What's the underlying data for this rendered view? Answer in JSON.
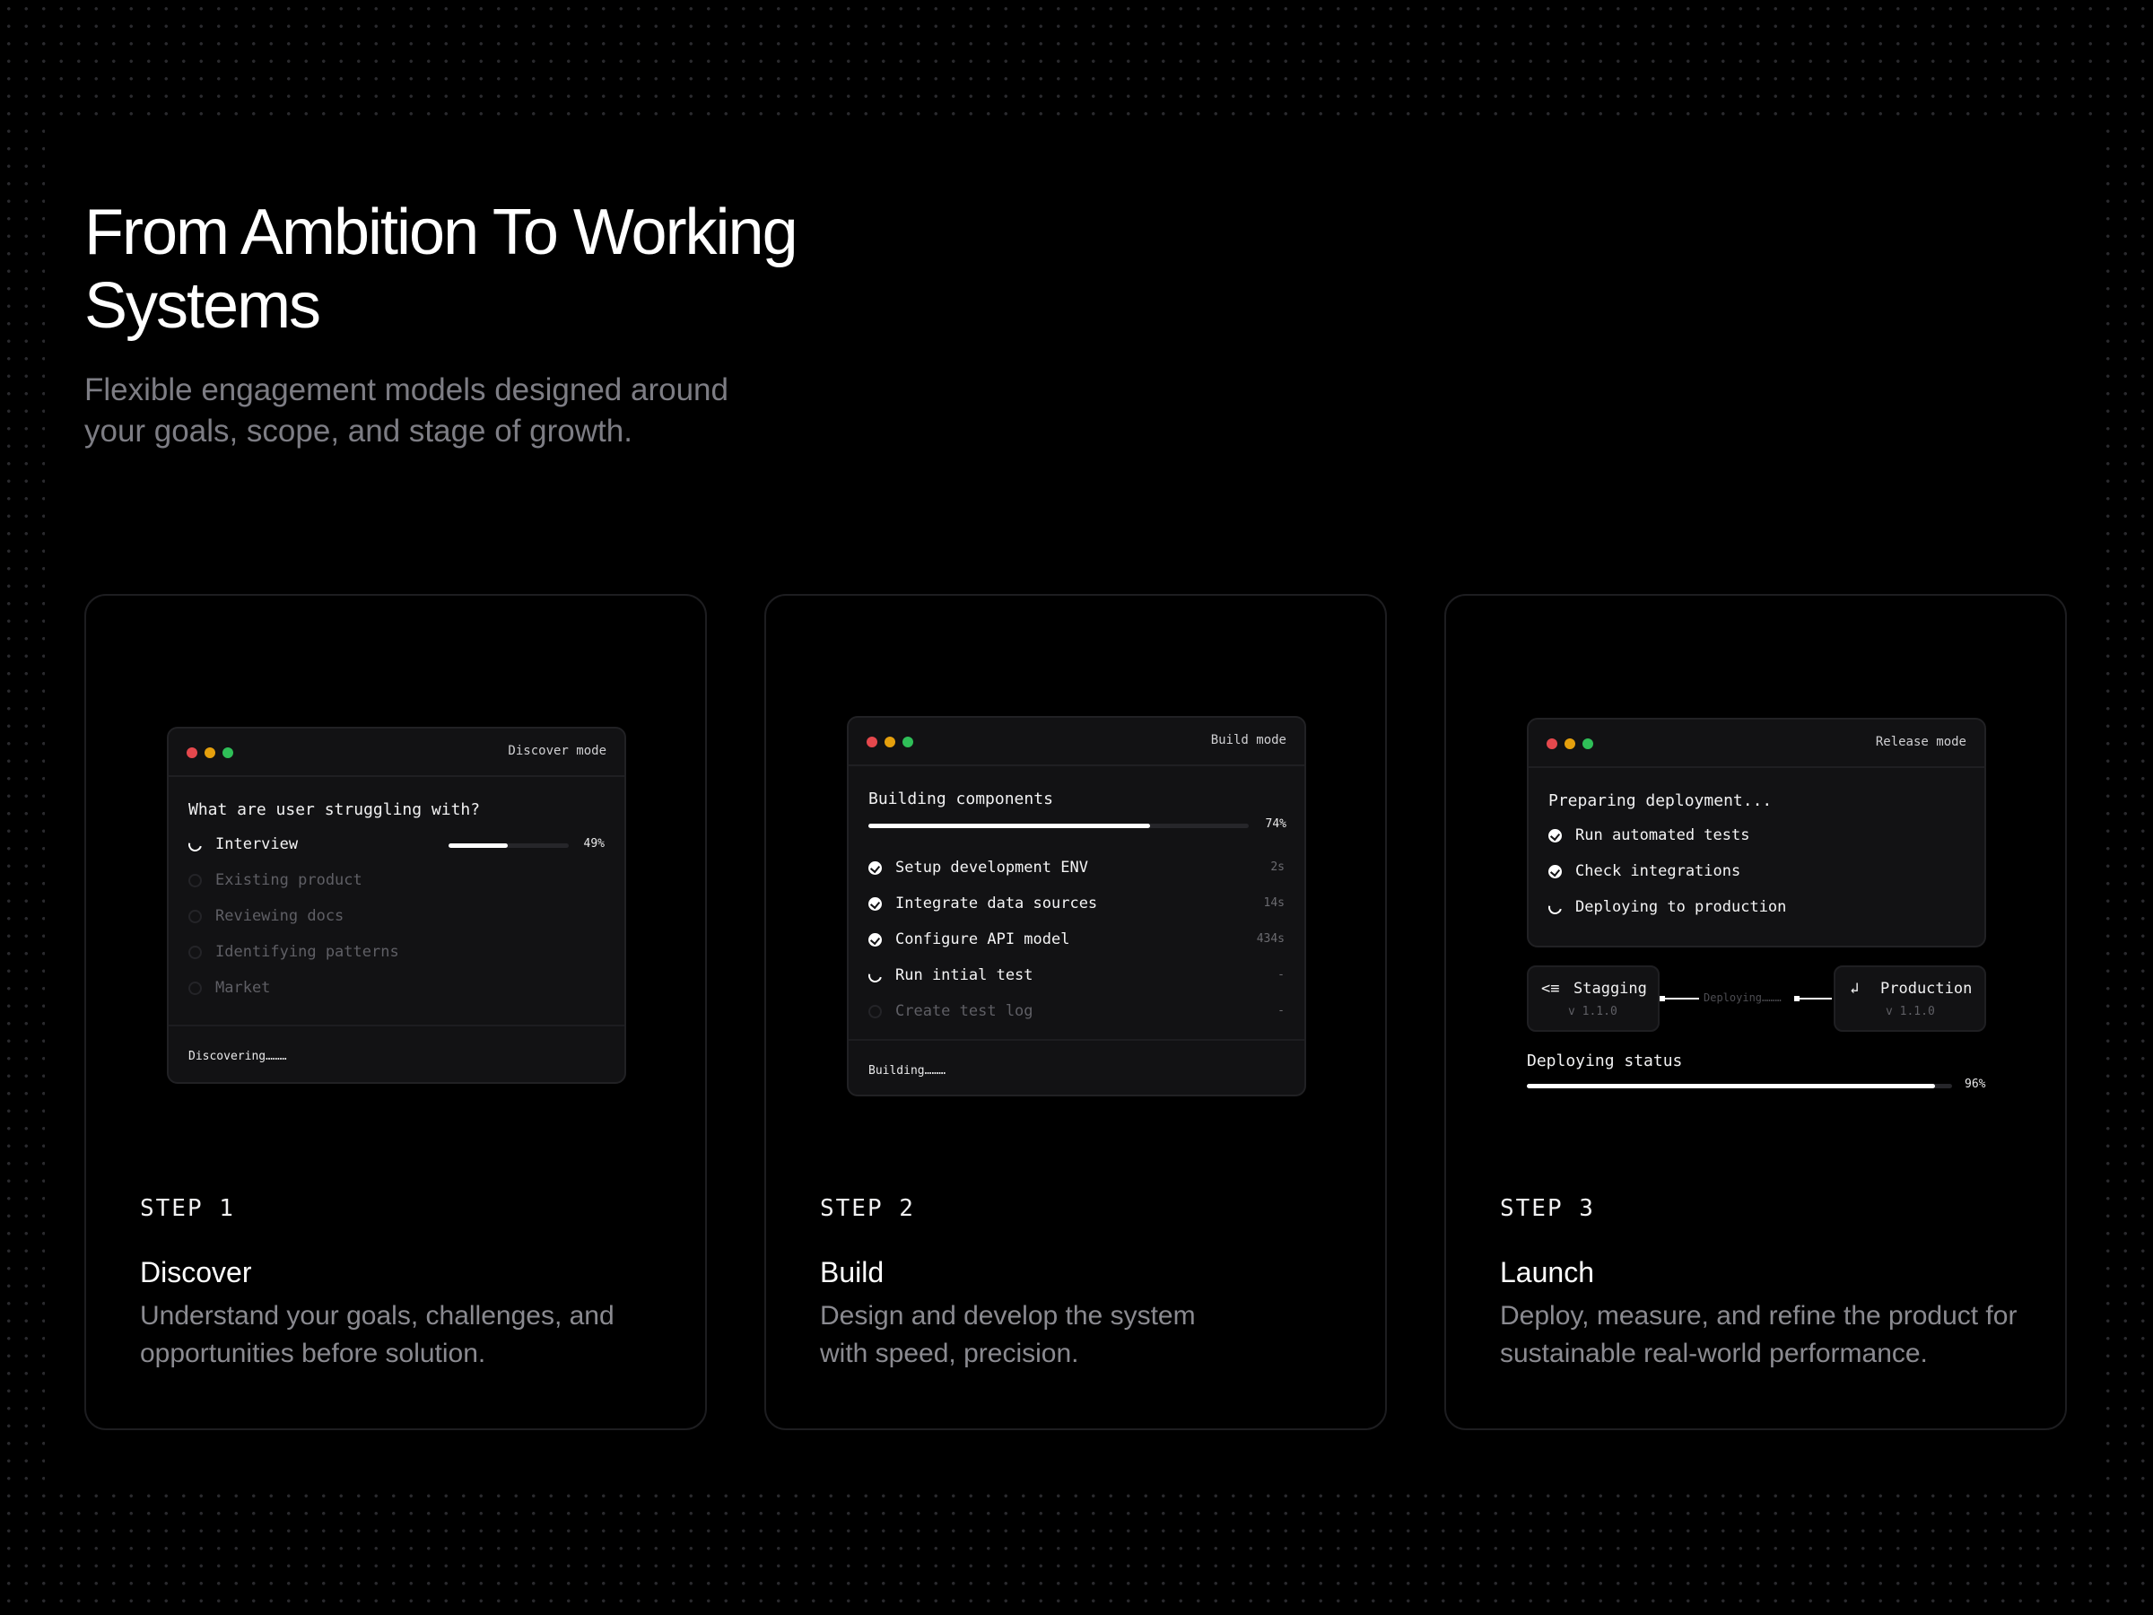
{
  "header": {
    "title": "From Ambition To Working Systems",
    "subtitle": "Flexible engagement models designed around your goals, scope, and stage of growth."
  },
  "colors": {
    "window_red": "#e5484d",
    "window_yellow": "#e5a00d",
    "window_green": "#2fbf58"
  },
  "steps": [
    {
      "label": "STEP 1",
      "title": "Discover",
      "description": "Understand your goals, challenges, and opportunities before solution.",
      "window": {
        "mode": "Discover mode",
        "question": "What are user struggling with?",
        "progress_item": {
          "label": "Interview",
          "percent_text": "49%",
          "percent": 0.49,
          "icon": "spinner-icon"
        },
        "items": [
          {
            "label": "Existing product",
            "icon": "idle-circle-icon"
          },
          {
            "label": "Reviewing docs",
            "icon": "idle-circle-icon"
          },
          {
            "label": "Identifying patterns",
            "icon": "idle-circle-icon"
          },
          {
            "label": "Market",
            "icon": "idle-circle-icon"
          }
        ],
        "footer": "Discovering………"
      }
    },
    {
      "label": "STEP 2",
      "title": "Build",
      "description": "Design and develop the system with speed, precision.",
      "window": {
        "mode": "Build mode",
        "heading": "Building components",
        "percent_text": "74%",
        "percent": 0.74,
        "tasks": [
          {
            "label": "Setup development ENV",
            "time": "2s",
            "state": "done",
            "icon": "check-circle-icon"
          },
          {
            "label": "Integrate data sources",
            "time": "14s",
            "state": "done",
            "icon": "check-circle-icon"
          },
          {
            "label": "Configure API model",
            "time": "434s",
            "state": "done",
            "icon": "check-circle-icon"
          },
          {
            "label": "Run intial test",
            "time": "-",
            "state": "running",
            "icon": "spinner-icon"
          },
          {
            "label": "Create test log",
            "time": "-",
            "state": "pending",
            "icon": "idle-circle-icon"
          }
        ],
        "footer": "Building………"
      }
    },
    {
      "label": "STEP 3",
      "title": "Launch",
      "description": "Deploy, measure, and refine the product for sustainable real-world performance.",
      "window": {
        "mode": "Release mode",
        "heading": "Preparing deployment...",
        "tasks": [
          {
            "label": "Run automated tests",
            "state": "done",
            "icon": "check-circle-icon"
          },
          {
            "label": "Check integrations",
            "state": "done",
            "icon": "check-circle-icon"
          },
          {
            "label": "Deploying to production",
            "state": "running",
            "icon": "spinner-icon"
          }
        ]
      },
      "pipeline": {
        "source": {
          "name": "Stagging",
          "version": "v 1.1.0",
          "icon": "<≡"
        },
        "connector": "Deploying………",
        "target": {
          "name": "Production",
          "version": "v 1.1.0",
          "icon": "↲"
        }
      },
      "status": {
        "label": "Deploying status",
        "percent_text": "96%",
        "percent": 0.96
      }
    }
  ]
}
